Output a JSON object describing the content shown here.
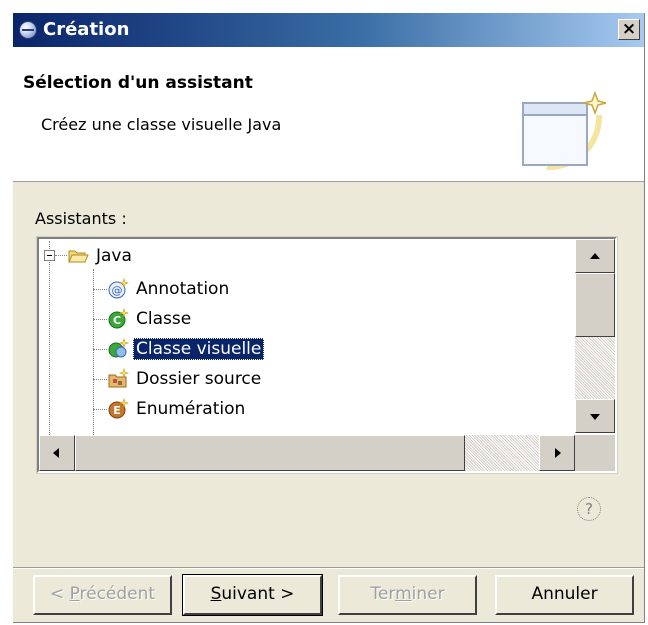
{
  "window": {
    "title": "Création",
    "close_label": "×"
  },
  "header": {
    "title": "Sélection d'un assistant",
    "description": "Créez une classe visuelle Java"
  },
  "assistants_label": "Assistants :",
  "tree": {
    "root": {
      "label": "Java",
      "icon": "folder-open-icon"
    },
    "items": [
      {
        "label": "Annotation",
        "icon": "annotation-icon"
      },
      {
        "label": "Classe",
        "icon": "class-icon"
      },
      {
        "label": "Classe visuelle",
        "icon": "visual-class-icon",
        "selected": true
      },
      {
        "label": "Dossier source",
        "icon": "source-folder-icon"
      },
      {
        "label": "Enumération",
        "icon": "enum-icon"
      }
    ]
  },
  "help_icon": "?",
  "buttons": {
    "back": {
      "pre": "< ",
      "mnemonic": "P",
      "post": "récédent",
      "enabled": false
    },
    "next": {
      "pre": "",
      "mnemonic": "S",
      "post": "uivant >",
      "enabled": true,
      "default": true
    },
    "finish": {
      "pre": "Ter",
      "mnemonic": "m",
      "post": "iner",
      "enabled": false
    },
    "cancel": {
      "label": "Annuler",
      "enabled": true
    }
  },
  "colors": {
    "title_bar_start": "#0a246a",
    "title_bar_end": "#a6caf0",
    "selection": "#0a246a",
    "dialog_bg": "#ece9d8"
  }
}
